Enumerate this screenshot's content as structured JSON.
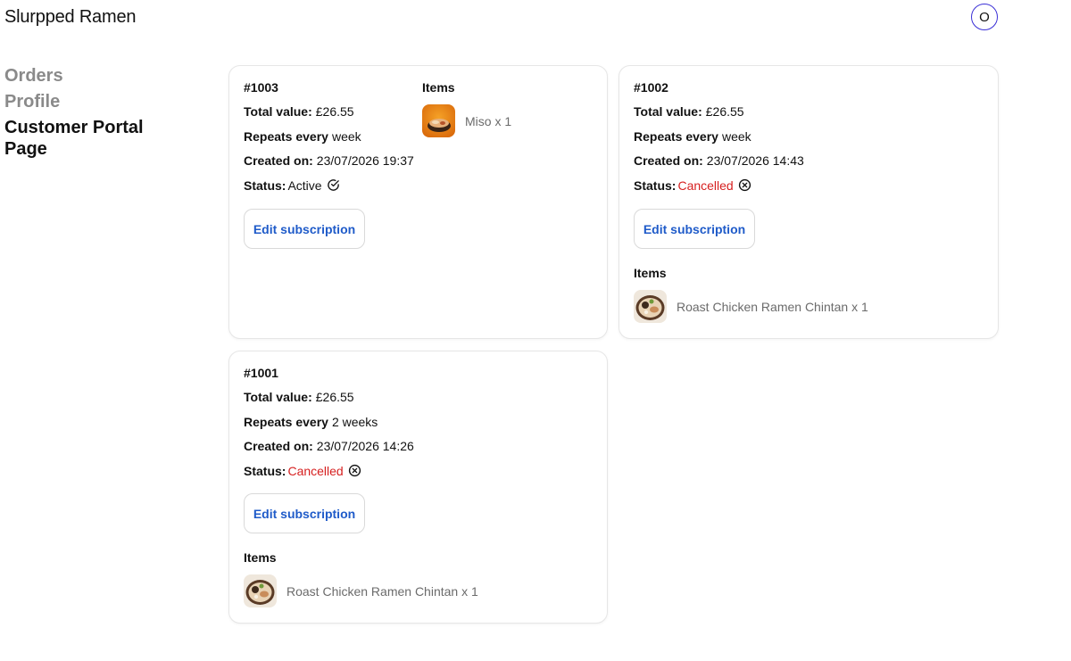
{
  "header": {
    "brand": "Slurpped Ramen",
    "avatar_initial": "O"
  },
  "sidebar": {
    "items": [
      {
        "label": "Orders",
        "active": false
      },
      {
        "label": "Profile",
        "active": false
      },
      {
        "label": "Customer Portal Page",
        "active": true
      }
    ]
  },
  "labels": {
    "total_value": "Total value:",
    "repeats_every": "Repeats every",
    "created_on": "Created on:",
    "status": "Status:",
    "items": "Items",
    "edit_button": "Edit subscription"
  },
  "colors": {
    "accent": "#1f5bc9",
    "cancelled": "#d61f1f",
    "avatar_ring": "#3a2fd6",
    "muted_nav": "#8a8a8a"
  },
  "subscriptions": [
    {
      "id": "#1003",
      "total": "£26.55",
      "repeats": "week",
      "created": "23/07/2026 19:37",
      "status": "Active",
      "status_icon": "check-circle-icon",
      "items": [
        {
          "name": "Miso x 1",
          "thumb_icon": "miso-ramen-thumbnail"
        }
      ]
    },
    {
      "id": "#1002",
      "total": "£26.55",
      "repeats": "week",
      "created": "23/07/2026 14:43",
      "status": "Cancelled",
      "status_icon": "x-circle-icon",
      "items": [
        {
          "name": "Roast Chicken Ramen Chintan x 1",
          "thumb_icon": "chicken-ramen-thumbnail"
        }
      ]
    },
    {
      "id": "#1001",
      "total": "£26.55",
      "repeats": "2 weeks",
      "created": "23/07/2026 14:26",
      "status": "Cancelled",
      "status_icon": "x-circle-icon",
      "items": [
        {
          "name": "Roast Chicken Ramen Chintan x 1",
          "thumb_icon": "chicken-ramen-thumbnail"
        }
      ]
    }
  ]
}
